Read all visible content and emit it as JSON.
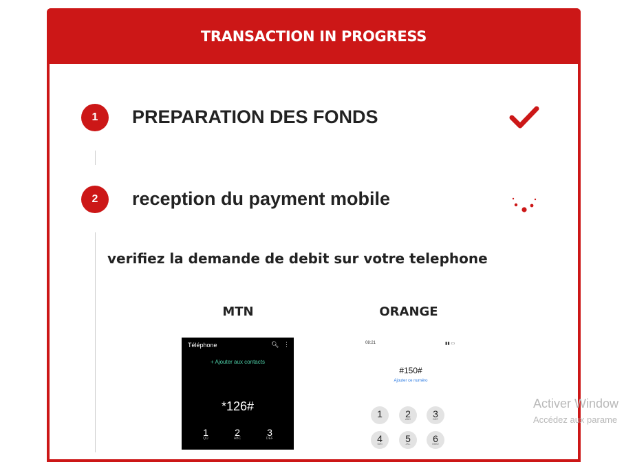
{
  "header": {
    "title": "TRANSACTION IN PROGRESS"
  },
  "colors": {
    "accent": "#cc1717",
    "text": "#222222"
  },
  "steps": [
    {
      "number": "1",
      "title": "PREPARATION DES FONDS",
      "status_icon": "check-icon"
    },
    {
      "number": "2",
      "title": "reception du payment mobile",
      "status_icon": "loading-spinner-icon"
    }
  ],
  "instruction": "verifiez la demande de debit sur votre telephone",
  "operators": [
    {
      "label": "MTN",
      "screen": {
        "title": "Téléphone",
        "add_contact": "+ Ajouter aux contacts",
        "code": "*126#",
        "keys": [
          {
            "digit": "1",
            "letters": "QΩ"
          },
          {
            "digit": "2",
            "letters": "ABC"
          },
          {
            "digit": "3",
            "letters": "DEF"
          }
        ]
      }
    },
    {
      "label": "ORANGE",
      "screen": {
        "time": "08:21",
        "code": "#150#",
        "add_number": "Ajouter ce numéro",
        "keys": [
          {
            "digit": "1",
            "letters": ""
          },
          {
            "digit": "2",
            "letters": "ABC"
          },
          {
            "digit": "3",
            "letters": "DEF"
          },
          {
            "digit": "4",
            "letters": "GHI"
          },
          {
            "digit": "5",
            "letters": "JKL"
          },
          {
            "digit": "6",
            "letters": "MNO"
          }
        ]
      }
    }
  ],
  "windows_watermark": {
    "line1": "Activer Window",
    "line2": "Accédez aux parame"
  }
}
